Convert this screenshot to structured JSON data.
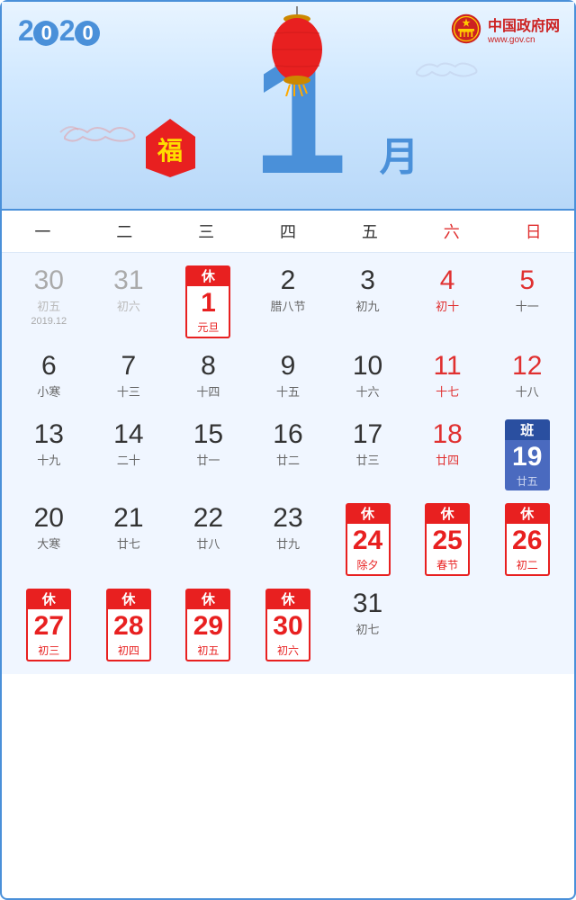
{
  "header": {
    "year": "2020",
    "month": "1",
    "yue": "月",
    "gov_name": "中国政府网",
    "gov_url": "www.gov.cn"
  },
  "weekdays": [
    {
      "label": "一",
      "weekend": false
    },
    {
      "label": "二",
      "weekend": false
    },
    {
      "label": "三",
      "weekend": false
    },
    {
      "label": "四",
      "weekend": false
    },
    {
      "label": "五",
      "weekend": false
    },
    {
      "label": "六",
      "weekend": true
    },
    {
      "label": "日",
      "weekend": true
    }
  ],
  "days": [
    {
      "num": "30",
      "lunar": "初五",
      "type": "prev",
      "col": 1
    },
    {
      "num": "31",
      "lunar": "初六",
      "type": "prev",
      "col": 2
    },
    {
      "num": "1",
      "lunar": "元旦",
      "type": "holiday",
      "badge": "休",
      "col": 3
    },
    {
      "num": "2",
      "lunar": "腊八节",
      "type": "normal",
      "col": 4
    },
    {
      "num": "3",
      "lunar": "初九",
      "type": "normal",
      "col": 5
    },
    {
      "num": "4",
      "lunar": "初十",
      "type": "weekend",
      "col": 6
    },
    {
      "num": "5",
      "lunar": "十一",
      "type": "weekend",
      "col": 7
    },
    {
      "num": "6",
      "lunar": "小寒",
      "type": "normal",
      "col": 1
    },
    {
      "num": "7",
      "lunar": "十三",
      "type": "normal",
      "col": 2
    },
    {
      "num": "8",
      "lunar": "十四",
      "type": "normal",
      "col": 3
    },
    {
      "num": "9",
      "lunar": "十五",
      "type": "normal",
      "col": 4
    },
    {
      "num": "10",
      "lunar": "十六",
      "type": "normal",
      "col": 5
    },
    {
      "num": "11",
      "lunar": "十七",
      "type": "weekend",
      "col": 6
    },
    {
      "num": "12",
      "lunar": "十八",
      "type": "weekend",
      "col": 7
    },
    {
      "num": "13",
      "lunar": "十九",
      "type": "normal",
      "col": 1
    },
    {
      "num": "14",
      "lunar": "二十",
      "type": "normal",
      "col": 2
    },
    {
      "num": "15",
      "lunar": "廿一",
      "type": "normal",
      "col": 3
    },
    {
      "num": "16",
      "lunar": "廿二",
      "type": "normal",
      "col": 4
    },
    {
      "num": "17",
      "lunar": "廿三",
      "type": "normal",
      "col": 5
    },
    {
      "num": "18",
      "lunar": "廿四",
      "type": "weekend",
      "col": 6
    },
    {
      "num": "19",
      "lunar": "廿五",
      "type": "work",
      "badge": "班",
      "col": 7
    },
    {
      "num": "20",
      "lunar": "大寒",
      "type": "normal",
      "col": 1
    },
    {
      "num": "21",
      "lunar": "廿七",
      "type": "normal",
      "col": 2
    },
    {
      "num": "22",
      "lunar": "廿八",
      "type": "normal",
      "col": 3
    },
    {
      "num": "23",
      "lunar": "廿九",
      "type": "normal",
      "col": 4
    },
    {
      "num": "24",
      "lunar": "除夕",
      "type": "holiday",
      "badge": "休",
      "col": 5
    },
    {
      "num": "25",
      "lunar": "春节",
      "type": "holiday",
      "badge": "休",
      "col": 6
    },
    {
      "num": "26",
      "lunar": "初二",
      "type": "holiday",
      "badge": "休",
      "col": 7
    },
    {
      "num": "27",
      "lunar": "初三",
      "type": "holiday",
      "badge": "休",
      "col": 1
    },
    {
      "num": "28",
      "lunar": "初四",
      "type": "holiday",
      "badge": "休",
      "col": 2
    },
    {
      "num": "29",
      "lunar": "初五",
      "type": "holiday",
      "badge": "休",
      "col": 3
    },
    {
      "num": "30",
      "lunar": "初六",
      "type": "holiday",
      "badge": "休",
      "col": 4
    },
    {
      "num": "31",
      "lunar": "初七",
      "type": "normal",
      "col": 5
    }
  ],
  "prev_year_label": "2019.12"
}
